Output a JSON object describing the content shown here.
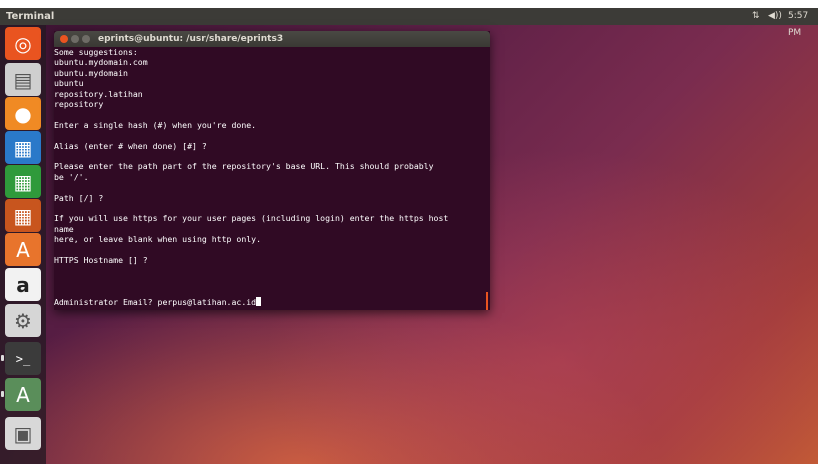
{
  "topbar": {
    "app_name": "Terminal",
    "network_indicator": "⇅",
    "volume_indicator": "◀))",
    "clock": "5:57 PM"
  },
  "launcher": {
    "items": [
      {
        "name": "ubuntu-dash",
        "glyph": "◎",
        "color": "#e95420"
      },
      {
        "name": "files",
        "glyph": "▤",
        "color": "#cfcfcf"
      },
      {
        "name": "firefox",
        "glyph": "●",
        "color": "#f08a24"
      },
      {
        "name": "libreoffice-writer",
        "glyph": "▦",
        "color": "#2a79c9"
      },
      {
        "name": "libreoffice-calc",
        "glyph": "▦",
        "color": "#2f9a3b"
      },
      {
        "name": "libreoffice-impress",
        "glyph": "▦",
        "color": "#c8551e"
      },
      {
        "name": "ubuntu-software",
        "glyph": "A",
        "color": "#e8742c"
      },
      {
        "name": "amazon",
        "glyph": "a",
        "color": "#f2f2f2"
      },
      {
        "name": "system-settings",
        "glyph": "⚙",
        "color": "#d6d6d6"
      },
      {
        "name": "terminal",
        "glyph": ">_",
        "color": "#3b3b3b"
      },
      {
        "name": "software-updater",
        "glyph": "A",
        "color": "#5a8e5a"
      },
      {
        "name": "floppy",
        "glyph": "▣",
        "color": "#d8d8d8"
      }
    ]
  },
  "terminal": {
    "title": "eprints@ubuntu: /usr/share/eprints3",
    "lines": [
      "Some suggestions:",
      "ubuntu.mydomain.com",
      "ubuntu.mydomain",
      "ubuntu",
      "repository.latihan",
      "repository",
      "",
      "Enter a single hash (#) when you're done.",
      "",
      "Alias (enter # when done) [#] ?",
      "",
      "Please enter the path part of the repository's base URL. This should probably",
      "be '/'.",
      "",
      "Path [/] ?",
      "",
      "If you will use https for your user pages (including login) enter the https host",
      "name",
      "here, or leave blank when using http only.",
      "",
      "HTTPS Hostname [] ?",
      "",
      "",
      ""
    ],
    "prompt": "Administrator Email? ",
    "input_value": "perpus@latihan.ac.id"
  }
}
